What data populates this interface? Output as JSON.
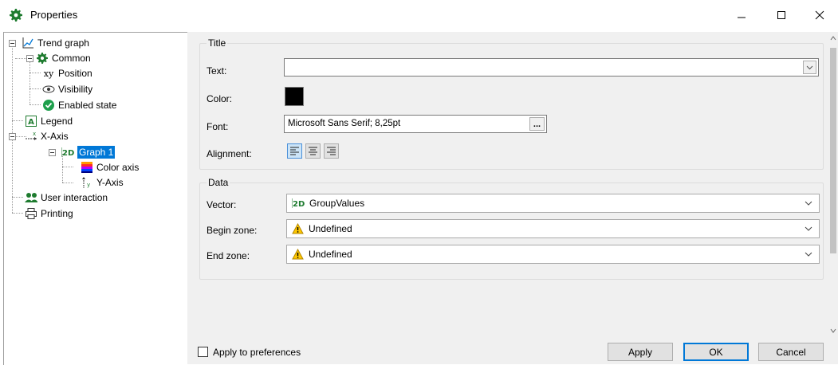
{
  "window": {
    "title": "Properties"
  },
  "tree": {
    "root": "Trend graph",
    "common": "Common",
    "position": "Position",
    "visibility": "Visibility",
    "enabled_state": "Enabled state",
    "legend": "Legend",
    "x_axis": "X-Axis",
    "graph1": "Graph 1",
    "color_axis": "Color axis",
    "y_axis": "Y-Axis",
    "user_interaction": "User interaction",
    "printing": "Printing"
  },
  "title_group": {
    "header": "Title",
    "text_label": "Text:",
    "text_value": "",
    "color_label": "Color:",
    "color_value": "#000000",
    "font_label": "Font:",
    "font_value": "Microsoft Sans Serif; 8,25pt",
    "font_button": "...",
    "alignment_label": "Alignment:"
  },
  "data_group": {
    "header": "Data",
    "vector_label": "Vector:",
    "vector_value": "GroupValues",
    "begin_label": "Begin zone:",
    "begin_value": "Undefined",
    "end_label": "End zone:",
    "end_value": "Undefined"
  },
  "bottom": {
    "apply_to_prefs": "Apply to preferences",
    "apply": "Apply",
    "ok": "OK",
    "cancel": "Cancel"
  },
  "colors": {
    "accent": "#0078d7",
    "gear": "#1e7b2f",
    "check": "#1e9f4c"
  }
}
